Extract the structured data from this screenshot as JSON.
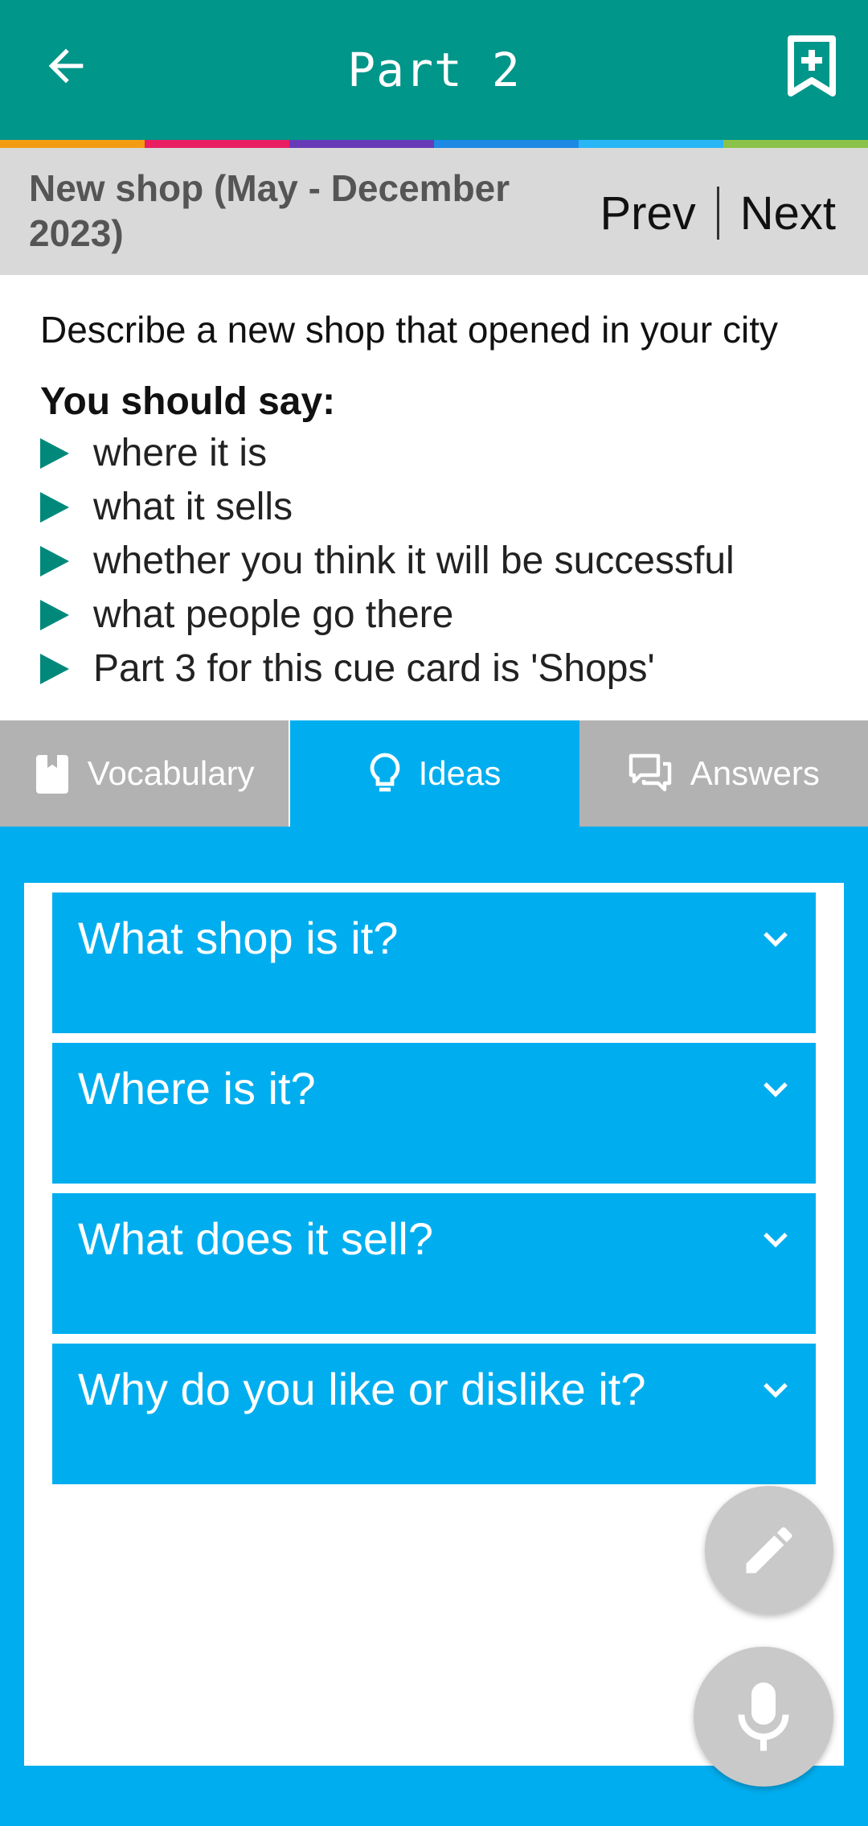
{
  "header": {
    "title": "Part 2",
    "back_icon": "arrow-back-icon",
    "bookmark_icon": "bookmark-add-icon",
    "bar_color": "#00968a"
  },
  "color_strip": [
    "#f39c12",
    "#e91e63",
    "#673ab7",
    "#3f51b5",
    "#03a9f4",
    "#8bc34a"
  ],
  "subheader": {
    "title": "New shop (May - December 2023)",
    "prev_label": "Prev",
    "next_label": "Next"
  },
  "cue_card": {
    "prompt": "Describe a new shop that opened in your city",
    "should_say": "You should say:",
    "points": [
      "where it is",
      "what it sells",
      "whether you think it will be successful",
      "what people go there",
      "Part 3 for this cue card is 'Shops'"
    ]
  },
  "tabs": [
    {
      "label": "Vocabulary",
      "icon": "book-icon",
      "active": false
    },
    {
      "label": "Ideas",
      "icon": "lightbulb-icon",
      "active": true
    },
    {
      "label": "Answers",
      "icon": "chat-bubbles-icon",
      "active": false
    }
  ],
  "ideas": [
    {
      "question": "What shop is it?"
    },
    {
      "question": "Where is it?"
    },
    {
      "question": "What does it sell?"
    },
    {
      "question": "Why do you like or dislike it?"
    }
  ],
  "fabs": {
    "edit_icon": "pencil-icon",
    "mic_icon": "microphone-icon"
  },
  "colors": {
    "accent": "#00aeef",
    "inactive_tab": "#b2b2b2",
    "bullet": "#00897b"
  }
}
